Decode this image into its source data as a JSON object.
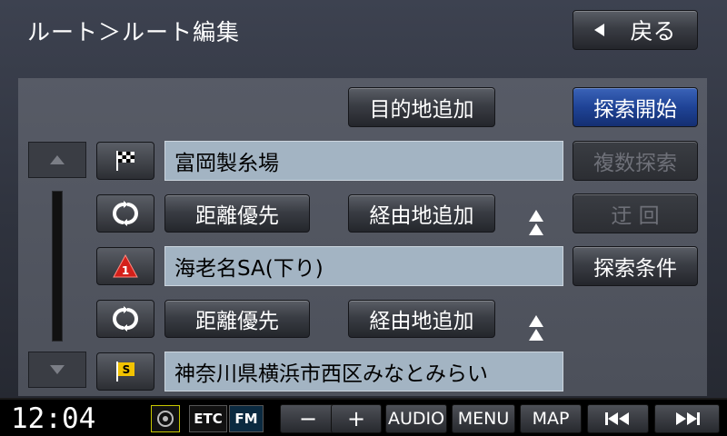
{
  "header": {
    "title": "ルート＞ルート編集",
    "back_label": "戻る"
  },
  "toolbar": {
    "add_destination_label": "目的地追加",
    "start_search_label": "探索開始"
  },
  "side_buttons": {
    "multi_search": "複数探索",
    "detour": "迂 回",
    "search_conditions": "探索条件"
  },
  "route": {
    "start": {
      "name": "富岡製糸場",
      "icon": "checkered-flag-icon"
    },
    "leg1": {
      "priority_label": "距離優先",
      "add_waypoint_label": "経由地追加"
    },
    "waypoint1": {
      "name": "海老名SA(下り)",
      "icon": "waypoint-1-icon",
      "number": "1"
    },
    "leg2": {
      "priority_label": "距離優先",
      "add_waypoint_label": "経由地追加"
    },
    "destination": {
      "name": "神奈川県横浜市西区みなとみらい",
      "icon": "s-flag-icon",
      "flag_letter": "S"
    }
  },
  "status_bar": {
    "time": "12:04",
    "etc_label": "ETC",
    "fm_label": "FM",
    "minus_label": "−",
    "plus_label": "+",
    "audio_label": "AUDIO",
    "menu_label": "MENU",
    "map_label": "MAP"
  },
  "colors": {
    "blue_button": "#1f4396",
    "field_bg": "#a3b4c3",
    "waypoint_red": "#d4201a",
    "flag_yellow": "#f2c300"
  }
}
